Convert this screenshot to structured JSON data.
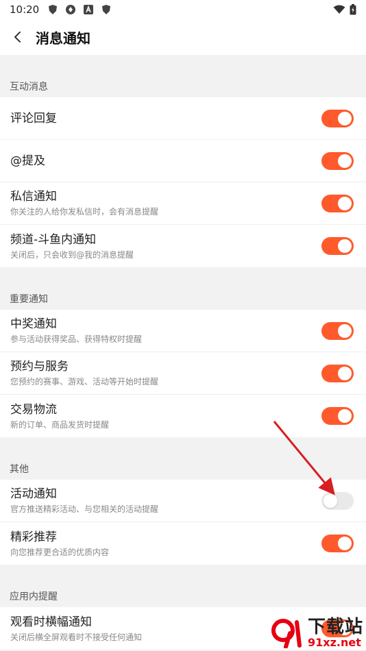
{
  "status_bar": {
    "time": "10:20"
  },
  "header": {
    "title": "消息通知"
  },
  "sections": [
    {
      "title": "互动消息",
      "items": [
        {
          "title": "评论回复",
          "subtitle": "",
          "enabled": true
        },
        {
          "title": "@提及",
          "subtitle": "",
          "enabled": true
        },
        {
          "title": "私信通知",
          "subtitle": "你关注的人给你发私信时，会有消息提醒",
          "enabled": true
        },
        {
          "title": "频道-斗鱼内通知",
          "subtitle": "关闭后，只会收到@我的消息提醒",
          "enabled": true
        }
      ]
    },
    {
      "title": "重要通知",
      "items": [
        {
          "title": "中奖通知",
          "subtitle": "参与活动获得奖品、获得特权时提醒",
          "enabled": true
        },
        {
          "title": "预约与服务",
          "subtitle": "您预约的赛事、游戏、活动等开始时提醒",
          "enabled": true
        },
        {
          "title": "交易物流",
          "subtitle": "新的订单、商品发货时提醒",
          "enabled": true
        }
      ]
    },
    {
      "title": "其他",
      "items": [
        {
          "title": "活动通知",
          "subtitle": "官方推送精彩活动、与您相关的活动提醒",
          "enabled": false
        },
        {
          "title": "精彩推荐",
          "subtitle": "向您推荐更合适的优质内容",
          "enabled": true
        }
      ]
    },
    {
      "title": "应用内提醒",
      "items": [
        {
          "title": "观看时横幅通知",
          "subtitle": "关闭后横全屏观看时不接受任何通知",
          "enabled": true
        }
      ]
    }
  ],
  "colors": {
    "accent": "#ff5a2c",
    "toggle_off": "#e9e9e9",
    "annotation_arrow": "#d81e1e"
  },
  "watermark": {
    "cn": "下载站",
    "en": "91xz.net"
  }
}
